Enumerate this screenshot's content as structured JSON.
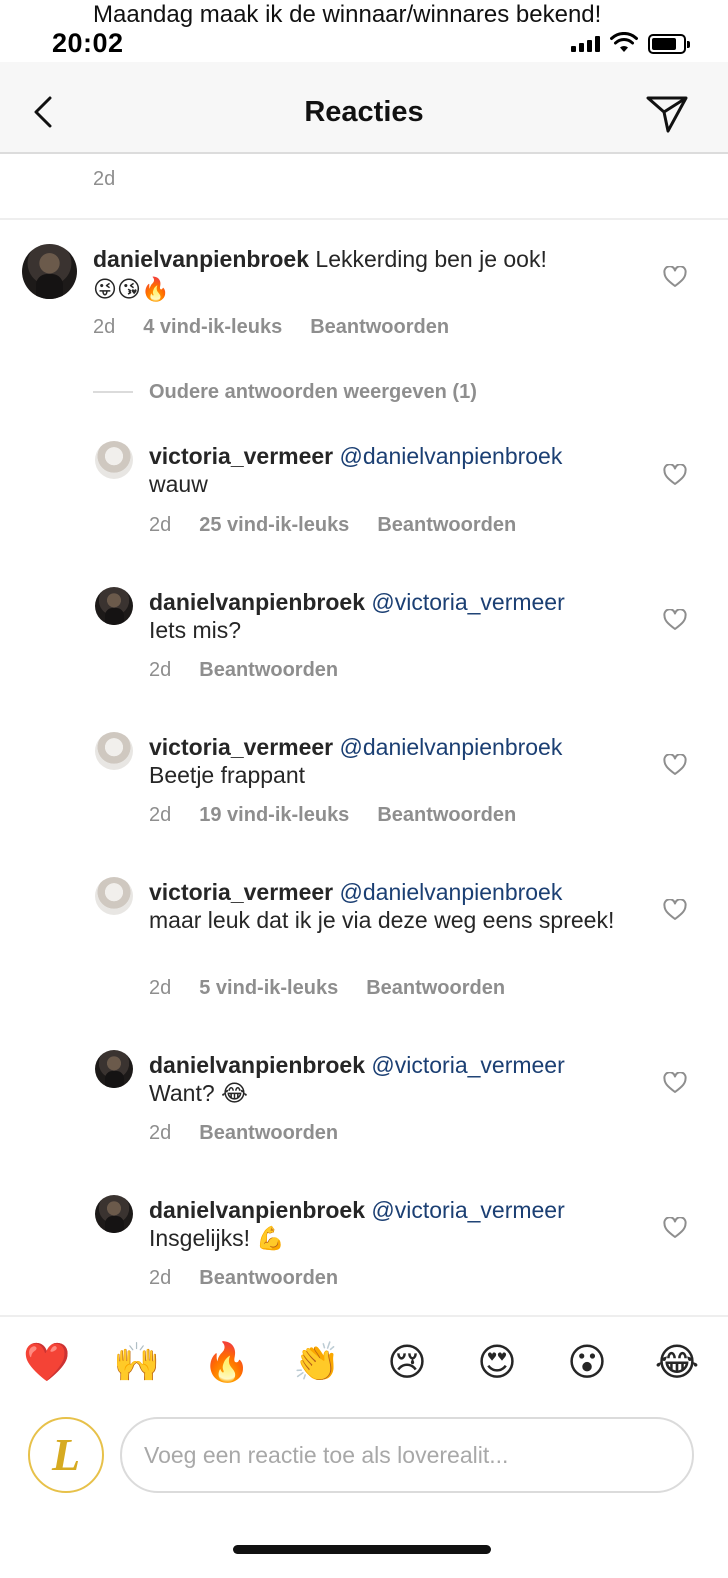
{
  "overlay": {
    "text": "Maandag maak ik de winnaar/winnares bekend!"
  },
  "status_bar": {
    "time": "20:02",
    "icons": [
      "cellular-signal-icon",
      "wifi-icon",
      "battery-icon"
    ]
  },
  "header": {
    "title": "Reacties",
    "back_icon": "chevron-left-icon",
    "send_icon": "paper-plane-icon"
  },
  "top_comment_time": "2d",
  "main_comment": {
    "username": "danielvanpienbroek",
    "text": "Lekkerding ben je ook!",
    "emojis": "😜😘🔥",
    "time": "2d",
    "likes": "4 vind-ik-leuks",
    "reply_label": "Beantwoorden"
  },
  "older_replies_label": "Oudere antwoorden weergeven (1)",
  "replies": [
    {
      "username": "victoria_vermeer",
      "mention": "@danielvanpienbroek",
      "text": "wauw",
      "time": "2d",
      "likes": "25 vind-ik-leuks",
      "reply_label": "Beantwoorden"
    },
    {
      "username": "danielvanpienbroek",
      "mention": "@victoria_vermeer",
      "text": "Iets mis?",
      "time": "2d",
      "reply_label": "Beantwoorden"
    },
    {
      "username": "victoria_vermeer",
      "mention": "@danielvanpienbroek",
      "text": "Beetje frappant",
      "time": "2d",
      "likes": "19 vind-ik-leuks",
      "reply_label": "Beantwoorden"
    },
    {
      "username": "victoria_vermeer",
      "mention": "@danielvanpienbroek",
      "text": "maar leuk dat ik je via deze weg eens spreek!",
      "time": "2d",
      "likes": "5 vind-ik-leuks",
      "reply_label": "Beantwoorden"
    },
    {
      "username": "danielvanpienbroek",
      "mention": "@victoria_vermeer",
      "text": "Want?",
      "emoji": "😂",
      "time": "2d",
      "reply_label": "Beantwoorden"
    },
    {
      "username": "danielvanpienbroek",
      "mention": "@victoria_vermeer",
      "text": "Insgelijks!",
      "emoji": "💪",
      "time": "2d",
      "reply_label": "Beantwoorden"
    }
  ],
  "quick_reactions": [
    "❤️",
    "🙌",
    "🔥",
    "👏",
    "😢",
    "😍",
    "😮",
    "😂"
  ],
  "composer": {
    "placeholder": "Voeg een reactie toe als loverealit...",
    "avatar_letter": "L"
  },
  "colors": {
    "mention": "#1b3f73",
    "meta_text": "#8e8e8e",
    "text": "#262626",
    "nav_background": "#f7f7f7"
  }
}
